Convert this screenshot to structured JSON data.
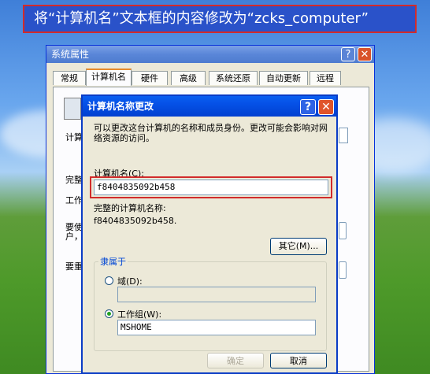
{
  "instruction": "将“计算机名”文本框的内容修改为“zcks_computer”",
  "outer_window": {
    "title": "系统属性",
    "help_glyph": "?",
    "close_glyph": "✕",
    "tabs": [
      "常规",
      "计算机名",
      "硬件",
      "高级",
      "系统还原",
      "自动更新",
      "远程"
    ],
    "active_tab": "计算机名",
    "side_labels": [
      "计算",
      "完整",
      "工作",
      "要使",
      "户，",
      "要重"
    ]
  },
  "dialog": {
    "title": "计算机名称更改",
    "help_glyph": "?",
    "close_glyph": "✕",
    "description": "可以更改这台计算机的名称和成员身份。更改可能会影响对网络资源的访问。",
    "computer_name_label": "计算机名(C):",
    "computer_name_value": "f8404835092b458",
    "full_name_label": "完整的计算机名称:",
    "full_name_value": "f8404835092b458.",
    "more_button": "其它(M)...",
    "member_of_label": "隶属于",
    "domain_label": "域(D):",
    "domain_value": "",
    "workgroup_label": "工作组(W):",
    "workgroup_value": "MSHOME",
    "ok_button": "确定",
    "cancel_button": "取消",
    "selected_membership": "workgroup"
  },
  "colors": {
    "banner_bg": "#2a52c9",
    "highlight": "#d12b2b",
    "xp_blue": "#0550e6"
  }
}
